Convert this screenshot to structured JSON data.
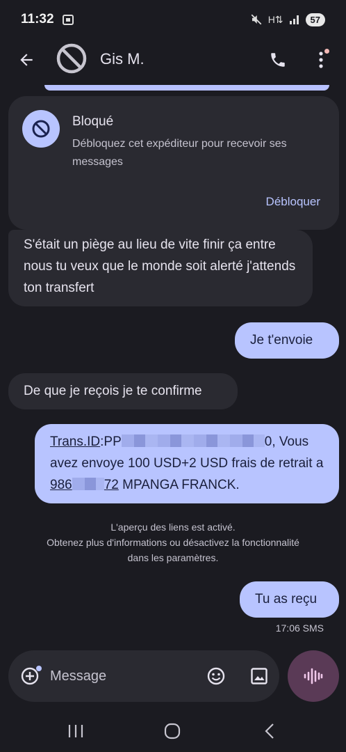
{
  "status_bar": {
    "time": "11:32",
    "battery": "57",
    "icons": [
      "screenshot-icon",
      "mute-icon",
      "data-icon",
      "signal-icon",
      "battery-icon"
    ]
  },
  "app_bar": {
    "contact_name": "Gis M.",
    "icons": [
      "back-arrow-icon",
      "blocked-avatar-icon",
      "phone-icon",
      "more-vert-icon"
    ]
  },
  "blocked_card": {
    "title": "Bloqué",
    "description": "Débloquez cet expéditeur pour recevoir ses messages",
    "action": "Débloquer"
  },
  "messages": [
    {
      "direction": "incoming",
      "text": "S'était un piège  au lieu de vite finir ça entre nous tu veux que le monde soit alerté j'attends ton transfert"
    },
    {
      "direction": "outgoing",
      "text": "Je t'envoie"
    },
    {
      "direction": "incoming",
      "text": "De que je reçois je te confirme"
    },
    {
      "direction": "outgoing",
      "parts": {
        "link1": "Trans.ID",
        "prefix": ":PP",
        "after_redact": "0, Vous avez envoye 100 USD+2 USD frais de retrait a ",
        "link2_start": "986",
        "link2_end": "72",
        "suffix": " MPANGA FRANCK."
      }
    },
    {
      "direction": "outgoing",
      "text": "Tu as reçu"
    }
  ],
  "link_preview_note": {
    "line1": "L'aperçu des liens est activé.",
    "line2": "Obtenez plus d'informations ou désactivez la fonctionnalité",
    "line3": "dans les paramètres."
  },
  "timestamp": "17:06 SMS",
  "compose": {
    "placeholder": "Message",
    "icons": [
      "add-icon",
      "emoji-icon",
      "gallery-icon",
      "voice-waveform-icon"
    ]
  },
  "nav_bar": {
    "icons": [
      "recents-icon",
      "home-icon",
      "nav-back-icon"
    ]
  },
  "colors": {
    "background": "#1b1b21",
    "incoming_bubble": "#2a2a31",
    "outgoing_bubble": "#b8c4ff",
    "accent": "#b8c4ff",
    "voice_button": "#5a3a56"
  }
}
